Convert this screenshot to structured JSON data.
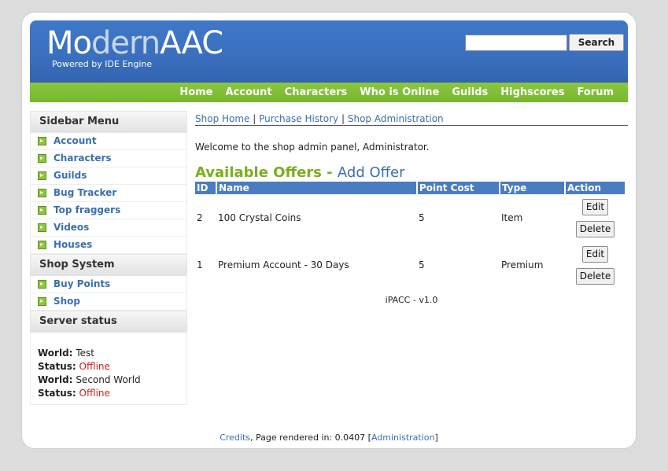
{
  "header": {
    "logo_part1": "Mo",
    "logo_part2": "dern",
    "logo_part3": "AAC",
    "tagline": "Powered by IDE Engine",
    "search_value": "",
    "search_button": "Search"
  },
  "nav": {
    "items": [
      "Home",
      "Account",
      "Characters",
      "Who is Online",
      "Guilds",
      "Highscores",
      "Forum"
    ]
  },
  "sidebar": {
    "menu_title": "Sidebar Menu",
    "menu_items": [
      "Account",
      "Characters",
      "Guilds",
      "Bug Tracker",
      "Top fraggers",
      "Videos",
      "Houses"
    ],
    "shop_title": "Shop System",
    "shop_items": [
      "Buy Points",
      "Shop"
    ],
    "status_title": "Server status",
    "servers": [
      {
        "world_label": "World:",
        "world": "Test",
        "status_label": "Status:",
        "status": "Offline"
      },
      {
        "world_label": "World:",
        "world": "Second World",
        "status_label": "Status:",
        "status": "Offline"
      }
    ]
  },
  "main": {
    "subnav": [
      "Shop Home",
      "Purchase History",
      "Shop Administration"
    ],
    "welcome": "Welcome to the shop admin panel, Administrator.",
    "offers_title": "Available Offers",
    "offers_dash": " - ",
    "add_offer": "Add Offer",
    "columns": [
      "ID",
      "Name",
      "Point Cost",
      "Type",
      "Action"
    ],
    "rows": [
      {
        "id": "2",
        "name": "100 Crystal Coins",
        "cost": "5",
        "type": "Item"
      },
      {
        "id": "1",
        "name": "Premium Account - 30 Days",
        "cost": "5",
        "type": "Premium"
      }
    ],
    "edit_label": "Edit",
    "delete_label": "Delete",
    "version": "iPACC - v1.0"
  },
  "footer": {
    "credits": "Credits",
    "rendered": ", Page rendered in: 0.0407 [",
    "admin": "Administration",
    "close": "]"
  },
  "colors": {
    "header_blue": "#3a6fbe",
    "nav_green": "#7fbe34",
    "link_blue": "#3a6fb0",
    "offline_red": "#d21e1e"
  }
}
